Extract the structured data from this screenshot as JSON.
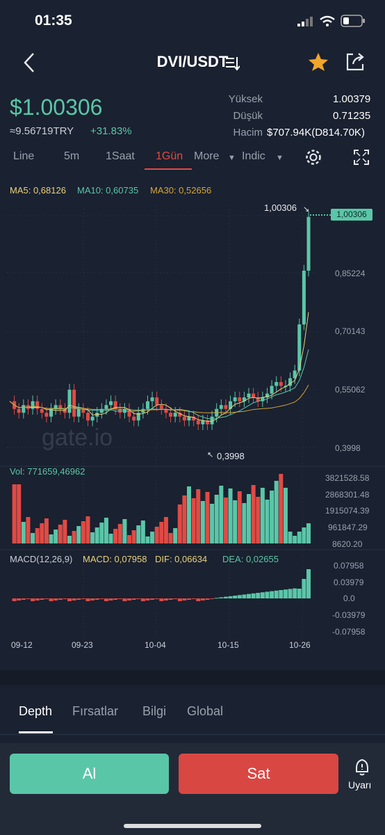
{
  "status": {
    "time": "01:35"
  },
  "nav": {
    "pair": "DVI/USDT"
  },
  "ticker": {
    "price": "$1.00306",
    "fiat": "≈9.56719TRY",
    "change": "+31.83%",
    "high_label": "Yüksek",
    "high": "1.00379",
    "low_label": "Düşük",
    "low": "0.71235",
    "vol_label": "Hacim",
    "vol": "$707.94K(D814.70K)"
  },
  "tabs": [
    "Line",
    "5m",
    "1Saat",
    "1Gün",
    "More",
    "Indic"
  ],
  "ma": {
    "ma5": "MA5: 0,68126",
    "ma10": "MA10: 0,60735",
    "ma30": "MA30: 0,52656"
  },
  "price_axis": [
    "0,85224",
    "0,70143",
    "0,55062",
    "0,3998"
  ],
  "last_price_tag": "1,00306",
  "high_marker": "1,00306",
  "low_marker": "0,3998",
  "watermark": "gate.io",
  "vol": {
    "label": "Vol: 771659,46962",
    "axis": [
      "3821528.58",
      "2868301.48",
      "1915074.39",
      "961847.29",
      "8620.20"
    ]
  },
  "macd": {
    "label": "MACD(12,26,9)",
    "macd": "MACD: 0,07958",
    "dif": "DIF: 0,06634",
    "dea": "DEA: 0,02655",
    "axis": [
      "0.07958",
      "0.03979",
      "0.0",
      "-0.03979",
      "-0.07958"
    ]
  },
  "dates": [
    "09-12",
    "09-23",
    "10-04",
    "10-15",
    "10-26"
  ],
  "bottom_tabs": [
    "Depth",
    "Fırsatlar",
    "Bilgi",
    "Global"
  ],
  "actions": {
    "buy": "Al",
    "sell": "Sat",
    "alert": "Uyarı"
  },
  "colors": {
    "up": "#5ac6a8",
    "down": "#e14a44",
    "bg": "#1a2130",
    "ma5": "#e8d27a",
    "ma10": "#5ac6a8",
    "ma30": "#d4a63a"
  }
}
